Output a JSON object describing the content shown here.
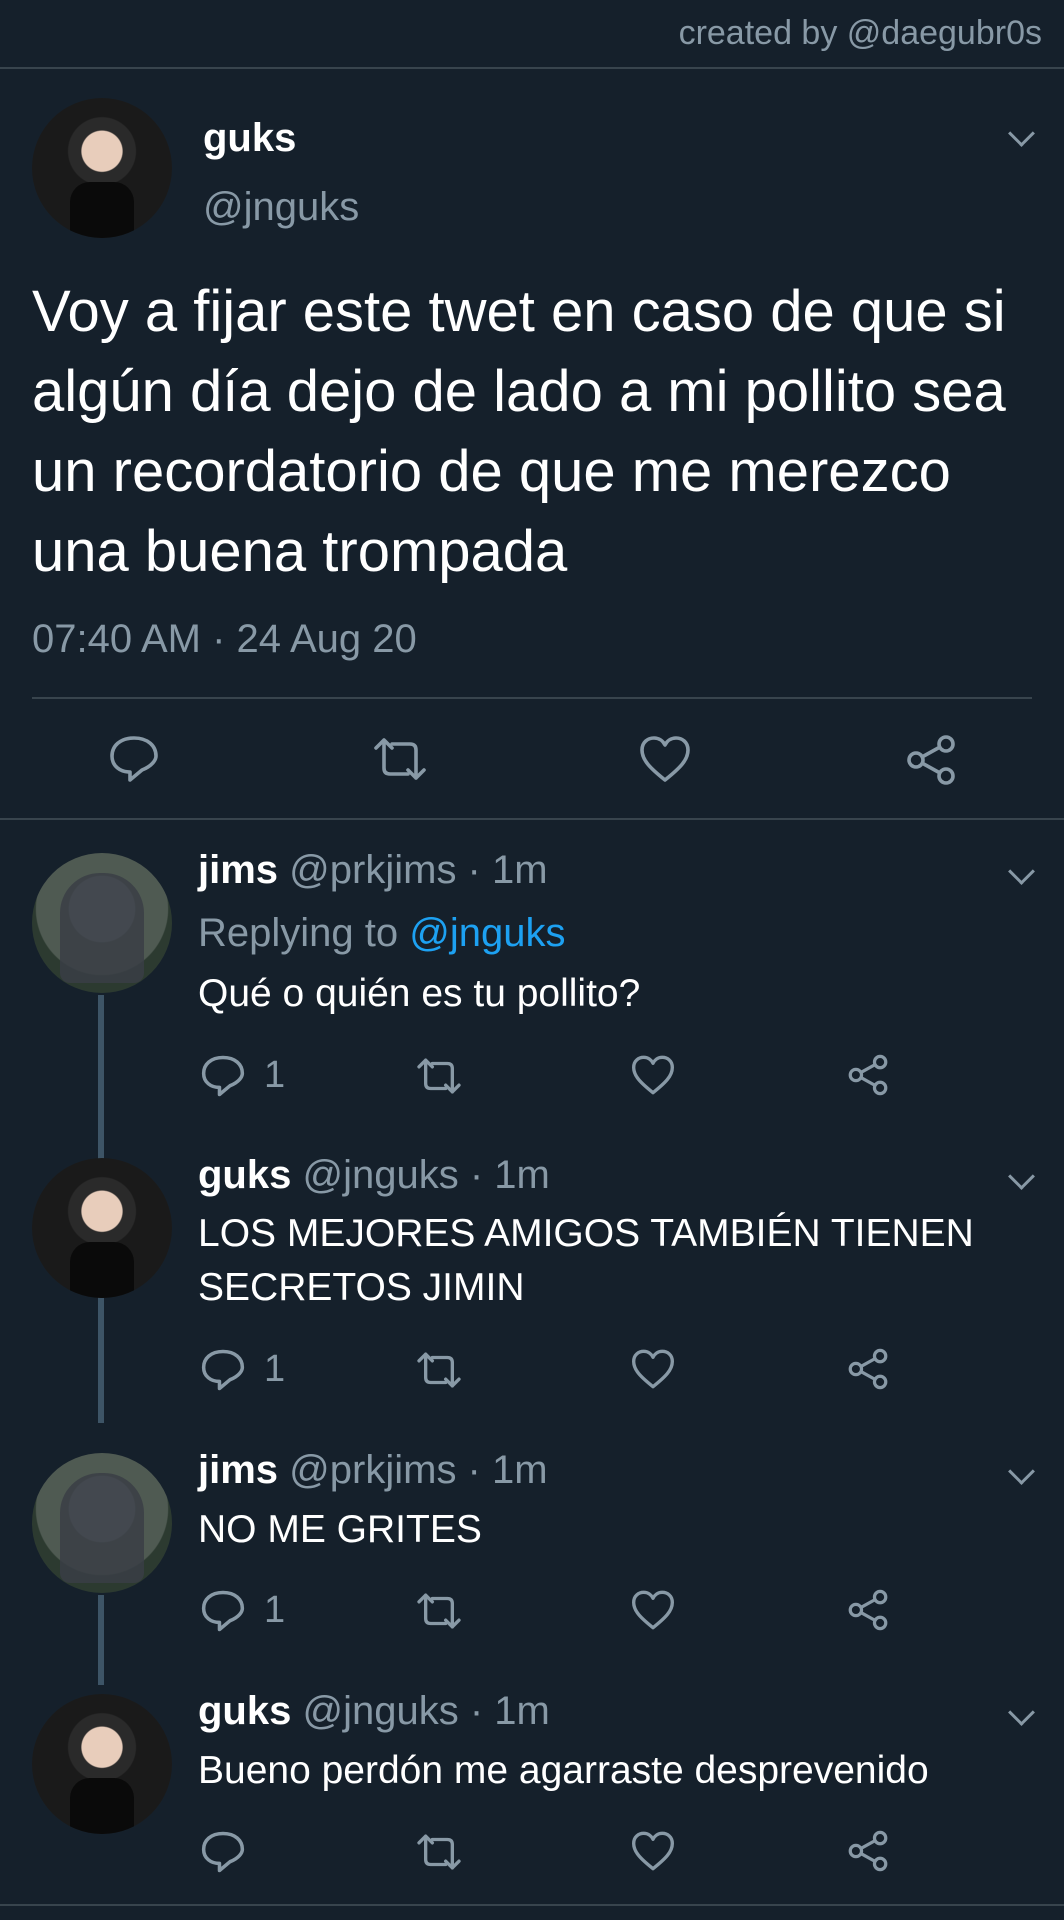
{
  "credit": "created by @daegubr0s",
  "main_tweet": {
    "name": "guks",
    "handle": "@jnguks",
    "text": "Voy a fijar este twet en caso de que si algún día dejo de lado a mi pollito sea un recordatorio de que me merezco una buena trompada",
    "timestamp": "07:40 AM · 24 Aug 20",
    "actions": [
      "reply-icon",
      "retweet-icon",
      "like-icon",
      "share-icon"
    ]
  },
  "replies": [
    {
      "name": "jims",
      "meta": "@prkjims · 1m",
      "replying_prefix": "Replying to ",
      "replying_to": "@jnguks",
      "text": "Qué o quién es tu pollito?",
      "reply_count": "1"
    },
    {
      "name": "guks",
      "meta": "@jnguks · 1m",
      "text": "LOS MEJORES AMIGOS TAMBIÉN TIENEN SECRETOS JIMIN",
      "reply_count": "1"
    },
    {
      "name": "jims",
      "meta": "@prkjims · 1m",
      "text": "NO ME GRITES",
      "reply_count": "1"
    },
    {
      "name": "guks",
      "meta": "@jnguks · 1m",
      "text": "Bueno perdón me agarraste desprevenido",
      "reply_count": ""
    }
  ],
  "colors": {
    "background": "#15202b",
    "secondary_text": "#8899a6",
    "link": "#1da1f2",
    "separator": "#38444d"
  }
}
